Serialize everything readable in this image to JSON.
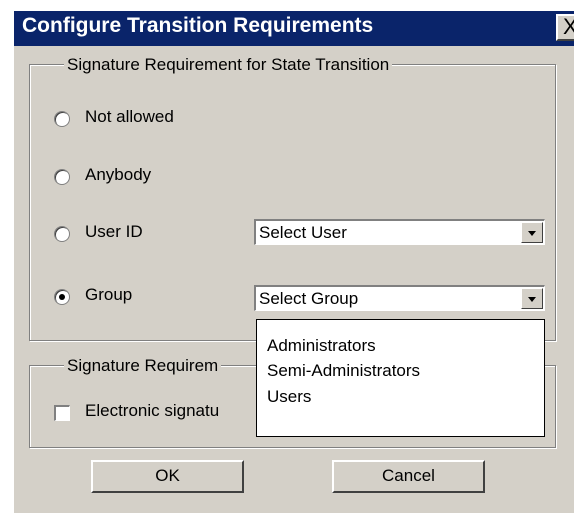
{
  "dialog": {
    "title": "Configure Transition Requirements",
    "close_label": "X"
  },
  "state_transition": {
    "legend": "Signature Requirement for State Transition",
    "options": [
      {
        "label": "Not allowed",
        "selected": false
      },
      {
        "label": "Anybody",
        "selected": false
      },
      {
        "label": "User ID",
        "selected": false
      },
      {
        "label": "Group",
        "selected": true
      }
    ],
    "user_select": {
      "value": "Select User"
    },
    "group_select": {
      "value": "Select Group"
    }
  },
  "group_dropdown": {
    "items": [
      "Administrators",
      "Semi-Administrators",
      "Users"
    ]
  },
  "signature_requirement": {
    "legend": "Signature Requirem",
    "checkbox_label": "Electronic signatu",
    "checked": false
  },
  "buttons": {
    "ok_label": "OK",
    "cancel_label": "Cancel"
  },
  "colors": {
    "title_bar": "#0a246a",
    "dialog_face": "#d4d0c8"
  }
}
